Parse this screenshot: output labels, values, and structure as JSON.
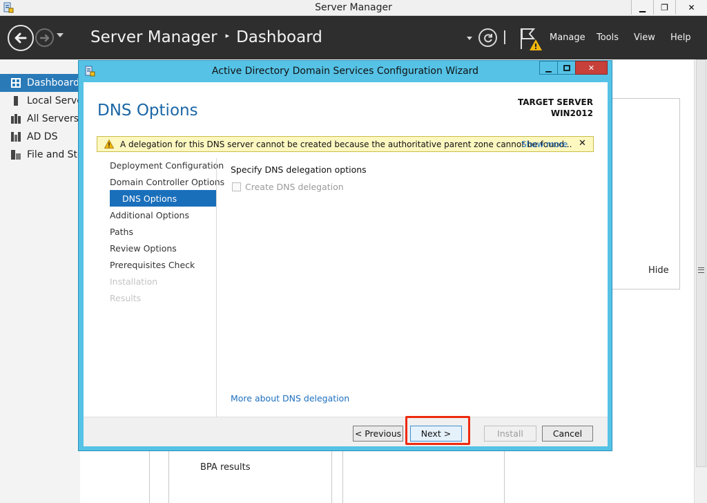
{
  "window": {
    "title": "Server Manager",
    "minimize_glyph": "▁",
    "restore_glyph": "❐",
    "close_glyph": "✕"
  },
  "header": {
    "app_name": "Server Manager",
    "separator": "▸",
    "page": "Dashboard",
    "menus": [
      "Manage",
      "Tools",
      "View",
      "Help"
    ]
  },
  "sidebar": {
    "items": [
      {
        "label": "Dashboard",
        "icon": "dashboard-icon",
        "active": true
      },
      {
        "label": "Local Server",
        "icon": "local-server-icon",
        "active": false
      },
      {
        "label": "All Servers",
        "icon": "all-servers-icon",
        "active": false
      },
      {
        "label": "AD DS",
        "icon": "ad-ds-icon",
        "active": false
      },
      {
        "label": "File and Storage Services",
        "icon": "file-storage-icon",
        "active": false
      }
    ]
  },
  "background": {
    "hide_label": "Hide",
    "bpa_label": "BPA results"
  },
  "wizard": {
    "title": "Active Directory Domain Services Configuration Wizard",
    "page_title": "DNS Options",
    "target_server_label": "TARGET SERVER",
    "target_server_name": "WIN2012",
    "warning": {
      "message": "A delegation for this DNS server cannot be created because the authoritative parent zone cannot be found...",
      "show_more": "Show more",
      "close": "✕"
    },
    "steps": [
      {
        "label": "Deployment Configuration",
        "state": "normal"
      },
      {
        "label": "Domain Controller Options",
        "state": "normal"
      },
      {
        "label": "DNS Options",
        "state": "active"
      },
      {
        "label": "Additional Options",
        "state": "normal"
      },
      {
        "label": "Paths",
        "state": "normal"
      },
      {
        "label": "Review Options",
        "state": "normal"
      },
      {
        "label": "Prerequisites Check",
        "state": "normal"
      },
      {
        "label": "Installation",
        "state": "disabled"
      },
      {
        "label": "Results",
        "state": "disabled"
      }
    ],
    "section_heading": "Specify DNS delegation options",
    "checkbox": {
      "label": "Create DNS delegation",
      "checked": false,
      "enabled": false
    },
    "more_link": "More about DNS delegation",
    "buttons": {
      "previous": "< Previous",
      "next": "Next >",
      "install": "Install",
      "cancel": "Cancel"
    }
  },
  "colors": {
    "header_bg": "#2e2e2e",
    "accent": "#1a6fbb",
    "wizard_frame": "#55c2e6",
    "highlight": "#ee2a0f"
  }
}
